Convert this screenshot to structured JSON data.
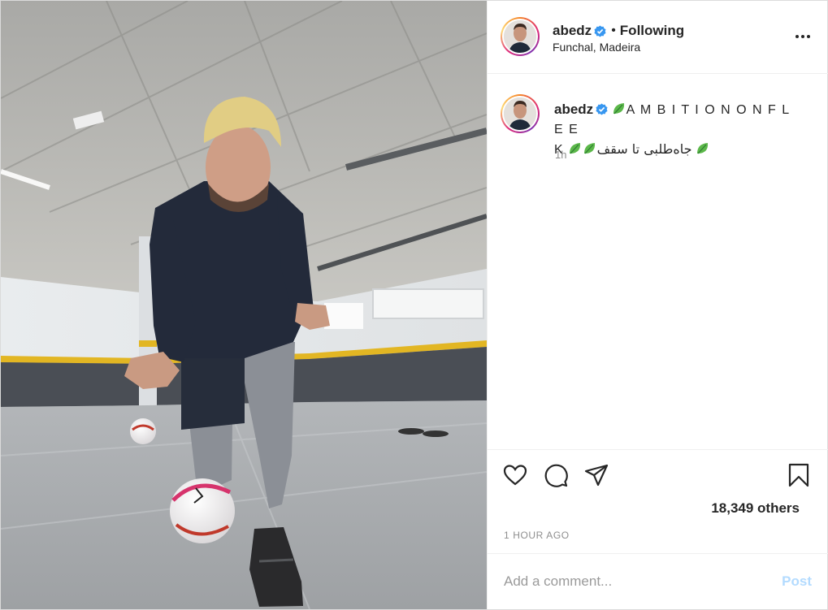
{
  "post": {
    "image_alt": "Man crouching with a football in an indoor parking garage",
    "header": {
      "username": "abedz",
      "separator": "•",
      "follow_status": "Following",
      "location": "Funchal, Madeira"
    },
    "caption": {
      "username": "abedz",
      "text_latin": "A M B I T I O N O N F L E E",
      "text_latin_end": "K",
      "text_persian": "جاه‌طلبی تا سقف",
      "time": "1h"
    },
    "likes": "18,349 others",
    "timestamp": "1 HOUR AGO",
    "comment": {
      "placeholder": "Add a comment...",
      "post_label": "Post"
    }
  },
  "colors": {
    "verified": "#3897f0",
    "post_button_disabled": "#b3dbff",
    "secondary_text": "#8e8e8e",
    "border": "#dbdbdb",
    "leaf_emoji": "#5cb84a"
  },
  "icons": [
    "more-options-icon",
    "verified-badge-icon",
    "leaf-emoji",
    "heart-icon",
    "comment-icon",
    "share-icon",
    "bookmark-icon"
  ]
}
